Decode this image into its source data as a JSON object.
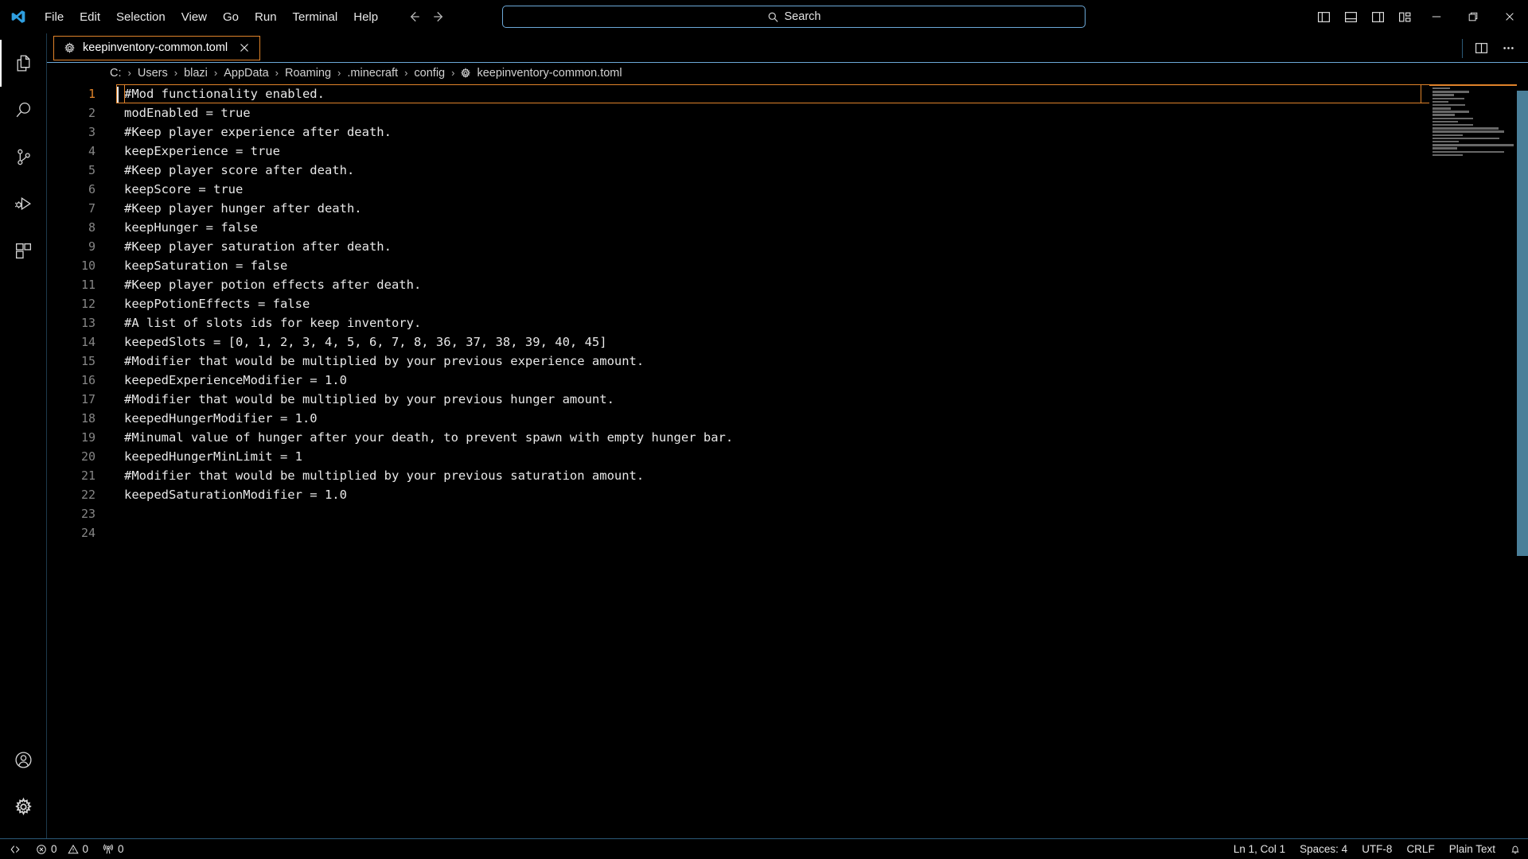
{
  "app": {
    "logo_icon": "vscode-logo"
  },
  "menubar": {
    "items": [
      {
        "label": "File"
      },
      {
        "label": "Edit"
      },
      {
        "label": "Selection"
      },
      {
        "label": "View"
      },
      {
        "label": "Go"
      },
      {
        "label": "Run"
      },
      {
        "label": "Terminal"
      },
      {
        "label": "Help"
      }
    ]
  },
  "navigation": {
    "back_icon": "arrow-left-icon",
    "forward_icon": "arrow-right-icon"
  },
  "search": {
    "placeholder": "Search",
    "icon": "search-icon",
    "border_color": "#6ca9d8"
  },
  "window_controls": {
    "toggle_primary_sidebar": "layout-primary-sidebar-icon",
    "toggle_panel": "layout-panel-icon",
    "toggle_secondary_sidebar": "layout-secondary-sidebar-icon",
    "customize_layout": "customize-layout-icon",
    "minimize": "minimize-icon",
    "maximize": "maximize-icon",
    "close": "close-icon"
  },
  "activitybar": {
    "items": [
      {
        "name": "explorer",
        "icon": "files-icon",
        "active": true
      },
      {
        "name": "search",
        "icon": "search-icon",
        "active": false
      },
      {
        "name": "source-control",
        "icon": "source-control-icon",
        "active": false
      },
      {
        "name": "run-and-debug",
        "icon": "run-debug-icon",
        "active": false
      },
      {
        "name": "extensions",
        "icon": "extensions-icon",
        "active": false
      }
    ],
    "bottom_items": [
      {
        "name": "accounts",
        "icon": "account-icon"
      },
      {
        "name": "manage",
        "icon": "gear-icon"
      }
    ]
  },
  "tabs": [
    {
      "label": "keepinventory-common.toml",
      "icon": "gear-icon",
      "close_icon": "close-icon",
      "active": true,
      "border_color": "#e0832a"
    }
  ],
  "tabbar_actions": {
    "split_editor": "split-editor-icon",
    "more_actions": "ellipsis-icon"
  },
  "breadcrumbs": {
    "segments": [
      {
        "label": "C:"
      },
      {
        "label": "Users"
      },
      {
        "label": "blazi"
      },
      {
        "label": "AppData"
      },
      {
        "label": "Roaming"
      },
      {
        "label": ".minecraft"
      },
      {
        "label": "config"
      },
      {
        "label": "keepinventory-common.toml",
        "icon": "gear-icon"
      }
    ],
    "separator": "›"
  },
  "editor": {
    "language": "Plain Text",
    "active_line": 1,
    "active_line_color": "#e0832a",
    "lines": [
      {
        "n": 1,
        "text": "#Mod functionality enabled."
      },
      {
        "n": 2,
        "text": "modEnabled = true"
      },
      {
        "n": 3,
        "text": "#Keep player experience after death."
      },
      {
        "n": 4,
        "text": "keepExperience = true"
      },
      {
        "n": 5,
        "text": "#Keep player score after death."
      },
      {
        "n": 6,
        "text": "keepScore = true"
      },
      {
        "n": 7,
        "text": "#Keep player hunger after death."
      },
      {
        "n": 8,
        "text": "keepHunger = false"
      },
      {
        "n": 9,
        "text": "#Keep player saturation after death."
      },
      {
        "n": 10,
        "text": "keepSaturation = false"
      },
      {
        "n": 11,
        "text": "#Keep player potion effects after death."
      },
      {
        "n": 12,
        "text": "keepPotionEffects = false"
      },
      {
        "n": 13,
        "text": "#A list of slots ids for keep inventory."
      },
      {
        "n": 14,
        "text": "keepedSlots = [0, 1, 2, 3, 4, 5, 6, 7, 8, 36, 37, 38, 39, 40, 45]"
      },
      {
        "n": 15,
        "text": "#Modifier that would be multiplied by your previous experience amount."
      },
      {
        "n": 16,
        "text": "keepedExperienceModifier = 1.0"
      },
      {
        "n": 17,
        "text": "#Modifier that would be multiplied by your previous hunger amount."
      },
      {
        "n": 18,
        "text": "keepedHungerModifier = 1.0"
      },
      {
        "n": 19,
        "text": "#Minumal value of hunger after your death, to prevent spawn with empty hunger bar."
      },
      {
        "n": 20,
        "text": "keepedHungerMinLimit = 1"
      },
      {
        "n": 21,
        "text": "#Modifier that would be multiplied by your previous saturation amount."
      },
      {
        "n": 22,
        "text": "keepedSaturationModifier = 1.0"
      },
      {
        "n": 23,
        "text": ""
      },
      {
        "n": 24,
        "text": ""
      }
    ]
  },
  "minimap": {
    "marker_color": "#e0832a",
    "scrollbar_color": "#4a7f99"
  },
  "statusbar": {
    "remote_icon": "remote-window-icon",
    "problems": [
      {
        "icon": "error-icon",
        "value": "0"
      },
      {
        "icon": "warning-icon",
        "value": "0"
      }
    ],
    "ports": {
      "icon": "radio-tower-icon",
      "value": "0"
    },
    "right_items": [
      {
        "name": "editor-position",
        "label": "Ln 1, Col 1"
      },
      {
        "name": "editor-indentation",
        "label": "Spaces: 4"
      },
      {
        "name": "editor-encoding",
        "label": "UTF-8"
      },
      {
        "name": "editor-eol",
        "label": "CRLF"
      },
      {
        "name": "editor-language",
        "label": "Plain Text"
      }
    ],
    "notifications_icon": "bell-icon"
  }
}
